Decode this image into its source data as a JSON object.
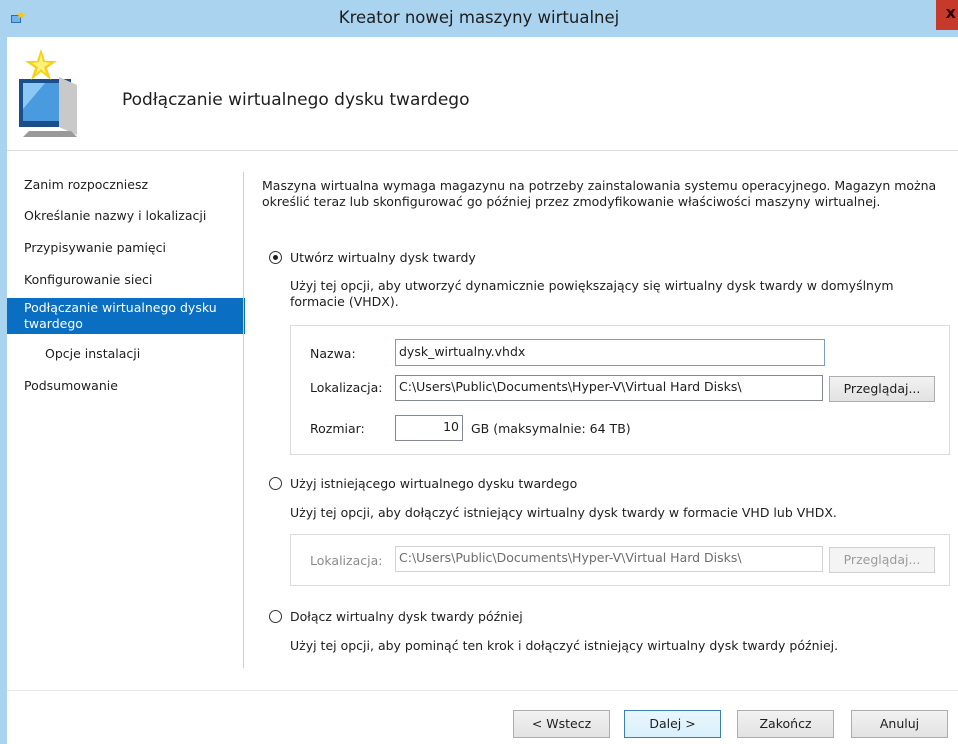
{
  "window": {
    "title": "Kreator nowej maszyny wirtualnej",
    "close_glyph": "x"
  },
  "header": {
    "title": "Podłączanie wirtualnego dysku twardego"
  },
  "nav": {
    "items": [
      {
        "label": "Zanim rozpoczniesz"
      },
      {
        "label": "Określanie nazwy i lokalizacji"
      },
      {
        "label": "Przypisywanie pamięci"
      },
      {
        "label": "Konfigurowanie sieci"
      },
      {
        "label": "Podłączanie wirtualnego dysku twardego"
      },
      {
        "label": "Opcje instalacji"
      },
      {
        "label": "Podsumowanie"
      }
    ]
  },
  "main": {
    "intro": "Maszyna wirtualna wymaga magazynu na potrzeby zainstalowania systemu operacyjnego. Magazyn można określić teraz lub skonfigurować go później przez zmodyfikowanie właściwości maszyny wirtualnej.",
    "option_create": {
      "label": "Utwórz wirtualny dysk twardy",
      "description": "Użyj tej opcji, aby utworzyć dynamicznie powiększający się wirtualny dysk twardy w domyślnym formacie (VHDX).",
      "name_label": "Nazwa:",
      "name_value": "dysk_wirtualny.vhdx",
      "location_label": "Lokalizacja:",
      "location_value": "C:\\Users\\Public\\Documents\\Hyper-V\\Virtual Hard Disks\\",
      "browse_label": "Przeglądaj...",
      "size_label": "Rozmiar:",
      "size_value": "10",
      "size_unit": "GB (maksymalnie: 64 TB)"
    },
    "option_existing": {
      "label": "Użyj istniejącego wirtualnego dysku twardego",
      "description": "Użyj tej opcji, aby dołączyć istniejący wirtualny dysk twardy w formacie VHD lub VHDX.",
      "location_label": "Lokalizacja:",
      "location_value": "C:\\Users\\Public\\Documents\\Hyper-V\\Virtual Hard Disks\\",
      "browse_label": "Przeglądaj..."
    },
    "option_later": {
      "label": "Dołącz wirtualny dysk twardy później",
      "description": "Użyj tej opcji, aby pominąć ten krok i dołączyć istniejący wirtualny dysk twardy później."
    }
  },
  "footer": {
    "back": "< Wstecz",
    "next": "Dalej >",
    "finish": "Zakończ",
    "cancel": "Anuluj"
  }
}
